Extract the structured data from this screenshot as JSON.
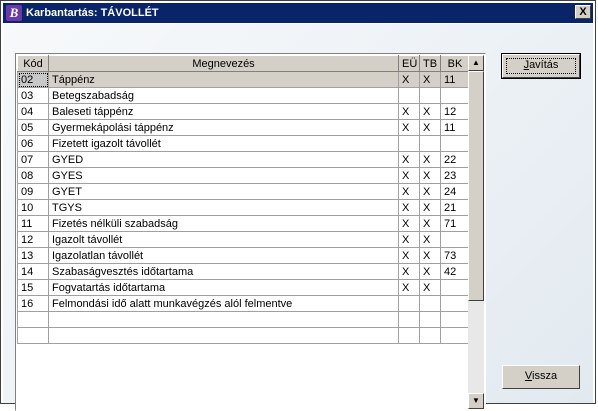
{
  "window": {
    "title": "Karbantartás: TÁVOLLÉT",
    "icon_letter": "B",
    "close_label": "X"
  },
  "grid": {
    "columns": [
      "Kód",
      "Megnevezés",
      "EÜ",
      "TB",
      "BK"
    ],
    "rows": [
      {
        "kod": "02",
        "nev": "Táppénz",
        "eu": "X",
        "tb": "X",
        "bk": "11"
      },
      {
        "kod": "03",
        "nev": "Betegszabadság",
        "eu": "",
        "tb": "",
        "bk": ""
      },
      {
        "kod": "04",
        "nev": "Baleseti táppénz",
        "eu": "X",
        "tb": "X",
        "bk": "12"
      },
      {
        "kod": "05",
        "nev": "Gyermekápolási táppénz",
        "eu": "X",
        "tb": "X",
        "bk": "11"
      },
      {
        "kod": "06",
        "nev": "Fizetett igazolt távollét",
        "eu": "",
        "tb": "",
        "bk": ""
      },
      {
        "kod": "07",
        "nev": "GYED",
        "eu": "X",
        "tb": "X",
        "bk": "22"
      },
      {
        "kod": "08",
        "nev": "GYES",
        "eu": "X",
        "tb": "X",
        "bk": "23"
      },
      {
        "kod": "09",
        "nev": "GYET",
        "eu": "X",
        "tb": "X",
        "bk": "24"
      },
      {
        "kod": "10",
        "nev": "TGYS",
        "eu": "X",
        "tb": "X",
        "bk": "21"
      },
      {
        "kod": "11",
        "nev": "Fizetés nélküli szabadság",
        "eu": "X",
        "tb": "X",
        "bk": "71"
      },
      {
        "kod": "12",
        "nev": "Igazolt távollét",
        "eu": "X",
        "tb": "X",
        "bk": ""
      },
      {
        "kod": "13",
        "nev": "Igazolatlan távollét",
        "eu": "X",
        "tb": "X",
        "bk": "73"
      },
      {
        "kod": "14",
        "nev": "Szabaságvesztés időtartama",
        "eu": "X",
        "tb": "X",
        "bk": "42"
      },
      {
        "kod": "15",
        "nev": "Fogvatartás időtartama",
        "eu": "X",
        "tb": "X",
        "bk": ""
      },
      {
        "kod": "16",
        "nev": "Felmondási idő alatt munkavégzés alól felmentve",
        "eu": "",
        "tb": "",
        "bk": ""
      }
    ],
    "selected_row": 0
  },
  "scrollbar": {
    "up_arrow": "▲",
    "down_arrow": "▼"
  },
  "buttons": {
    "edit_label": "Javítás",
    "edit_accel": "J",
    "edit_rest": "avítás",
    "back_label": "Vissza",
    "back_accel": "V",
    "back_rest": "issza"
  }
}
